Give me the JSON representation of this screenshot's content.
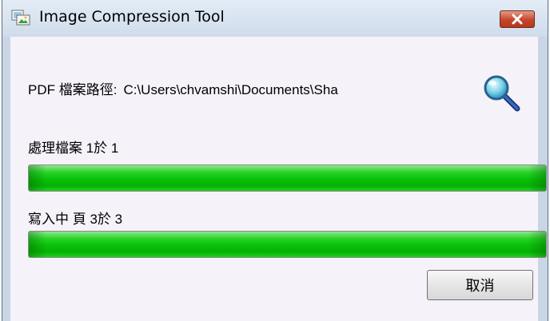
{
  "window": {
    "title": "Image Compression Tool"
  },
  "file_path": {
    "label": "PDF 檔案路徑:",
    "value": "C:\\Users\\chvamshi\\Documents\\Sha"
  },
  "file_progress": {
    "label": "處理檔案 1於 1",
    "percent": 100
  },
  "page_progress": {
    "label": "寫入中 頁 3於 3",
    "percent": 100
  },
  "buttons": {
    "cancel": "取消"
  },
  "icons": {
    "app": "image-compression-app-icon",
    "browse": "magnifier-icon",
    "close": "close-icon"
  },
  "colors": {
    "progress_fill": "#08c108",
    "close_button": "#c5452b"
  }
}
